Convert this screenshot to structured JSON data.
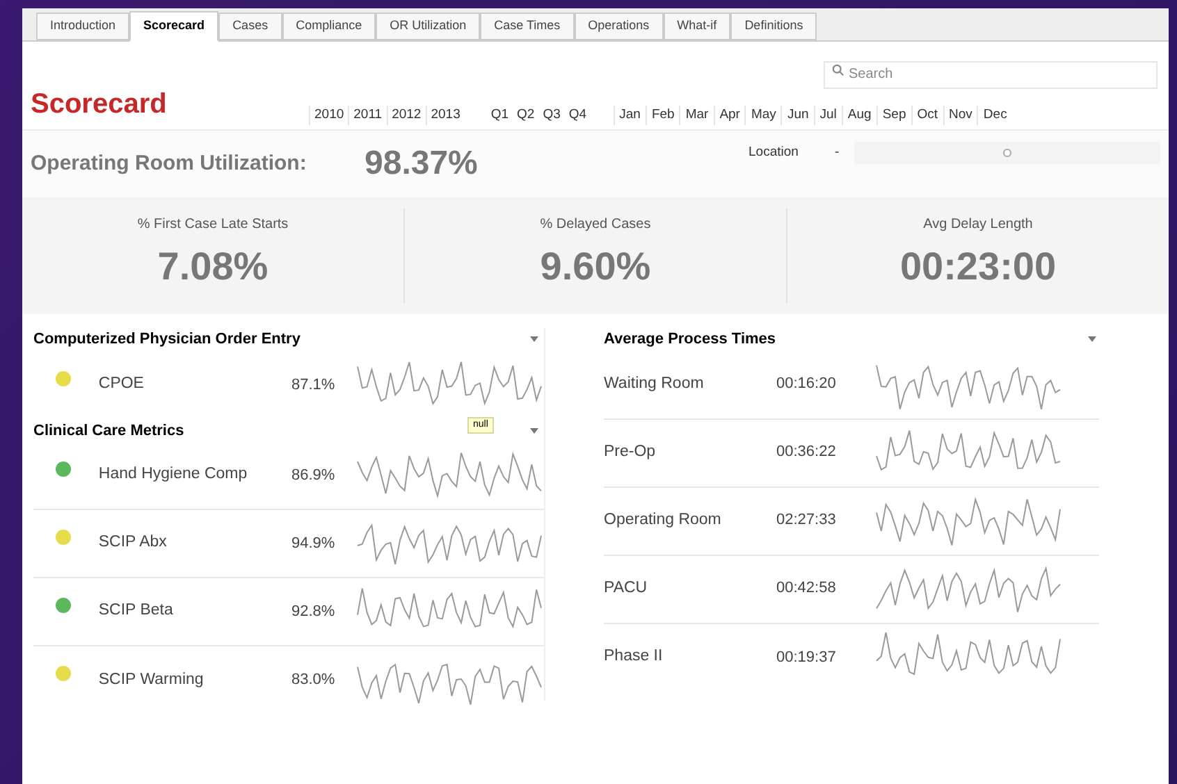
{
  "tabs": [
    {
      "label": "Introduction",
      "selected": false
    },
    {
      "label": "Scorecard",
      "selected": true
    },
    {
      "label": "Cases",
      "selected": false
    },
    {
      "label": "Compliance",
      "selected": false
    },
    {
      "label": "OR Utilization",
      "selected": false
    },
    {
      "label": "Case Times",
      "selected": false
    },
    {
      "label": "Operations",
      "selected": false
    },
    {
      "label": "What-if",
      "selected": false
    },
    {
      "label": "Definitions",
      "selected": false
    }
  ],
  "search": {
    "placeholder": "Search"
  },
  "title": "Scorecard",
  "years": [
    "2010",
    "2011",
    "2012",
    "2013"
  ],
  "quarters": [
    "Q1",
    "Q2",
    "Q3",
    "Q4"
  ],
  "months": [
    "Jan",
    "Feb",
    "Mar",
    "Apr",
    "May",
    "Jun",
    "Jul",
    "Aug",
    "Sep",
    "Oct",
    "Nov",
    "Dec"
  ],
  "utilization": {
    "label": "Operating Room Utilization:",
    "value": "98.37%"
  },
  "location": {
    "label": "Location",
    "value": "-",
    "level": 0.5
  },
  "kpis": [
    {
      "label": "% First Case Late Starts",
      "value": "7.08%"
    },
    {
      "label": "% Delayed Cases",
      "value": "9.60%"
    },
    {
      "label": "Avg Delay Length",
      "value": "00:23:00"
    }
  ],
  "left_sections": [
    {
      "title": "Computerized Physician Order Entry",
      "rows": [
        {
          "name": "CPOE",
          "value": "87.1%",
          "color": "#e6dc4a"
        }
      ]
    },
    {
      "title": "Clinical Care Metrics",
      "tooltip": "null",
      "rows": [
        {
          "name": "Hand Hygiene Comp",
          "value": "86.9%",
          "color": "#5cb85c"
        },
        {
          "name": "SCIP Abx",
          "value": "94.9%",
          "color": "#e6dc4a"
        },
        {
          "name": "SCIP Beta",
          "value": "92.8%",
          "color": "#5cb85c"
        },
        {
          "name": "SCIP Warming",
          "value": "83.0%",
          "color": "#e6dc4a"
        }
      ]
    }
  ],
  "process_times": {
    "title": "Average Process Times",
    "rows": [
      {
        "name": "Waiting Room",
        "value": "00:16:20"
      },
      {
        "name": "Pre-Op",
        "value": "00:36:22"
      },
      {
        "name": "Operating Room",
        "value": "02:27:33"
      },
      {
        "name": "PACU",
        "value": "00:42:58"
      },
      {
        "name": "Phase II",
        "value": "00:19:37"
      }
    ]
  }
}
